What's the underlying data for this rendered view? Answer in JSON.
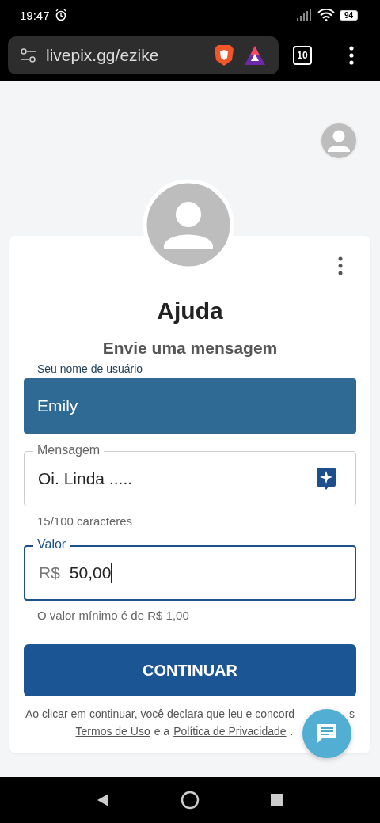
{
  "status_bar": {
    "time": "19:47",
    "battery": "94"
  },
  "browser": {
    "url": "livepix.gg/ezike",
    "tab_count": "10"
  },
  "card": {
    "title": "Ajuda",
    "subtitle": "Envie uma mensagem"
  },
  "fields": [
    {
      "kind": "filled",
      "label": "Seu nome de usuário",
      "value": "Emily"
    },
    {
      "kind": "outlined",
      "label": "Mensagem",
      "value": "Oi. Linda .....",
      "helper": "15/100 caracteres",
      "focused": false
    },
    {
      "kind": "outlined",
      "label": "Valor",
      "prefix": "R$",
      "value": "50,00",
      "helper": "O valor mínimo é de R$ 1,00",
      "focused": true
    }
  ],
  "continue_button": "CONTINUAR",
  "terms": {
    "line_start": "Ao clicar em continuar, você declara que leu e concord",
    "line_end": "s",
    "terms_link": "Termos de Uso",
    "middle": "e a",
    "privacy_link": "Política de Privacidade",
    "end": "."
  }
}
